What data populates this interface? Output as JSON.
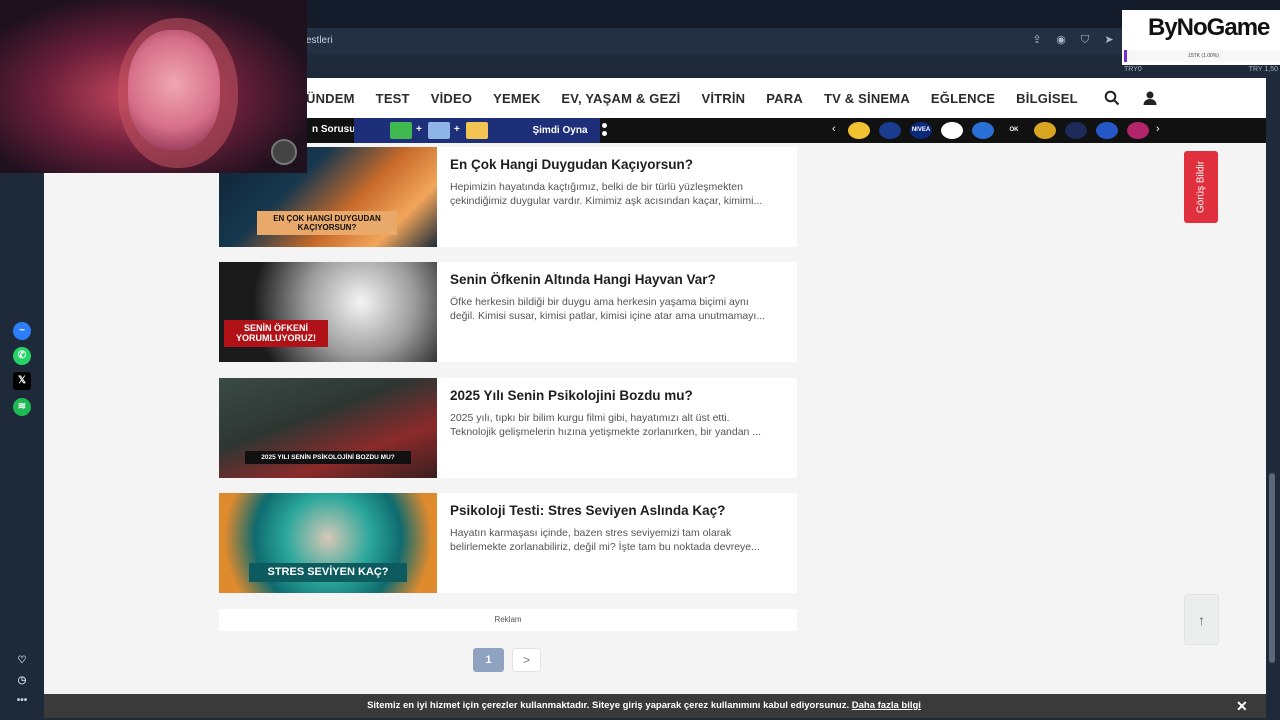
{
  "browser": {
    "address_partial": "estleri"
  },
  "nav": {
    "items": [
      "ÜNDEM",
      "TEST",
      "VİDEO",
      "YEMEK",
      "EV, YAŞAM & GEZİ",
      "VİTRİN",
      "PARA",
      "TV & SİNEMA",
      "EĞLENCE",
      "BİLGİSEL"
    ]
  },
  "strip": {
    "question_label": "n Sorusu",
    "play_label": "Şimdi Oyna"
  },
  "articles": [
    {
      "title": "En Çok Hangi Duygudan Kaçıyorsun?",
      "desc1": "Hepimizin hayatında kaçtığımız, belki de bir türlü yüzleşmekten",
      "desc2": "çekindiğimiz duygular vardır. Kimimiz aşk acısından kaçar, kimimi...",
      "thumb_caption": "EN ÇOK HANGİ DUYGUDAN KAÇIYORSUN?"
    },
    {
      "title": "Senin Öfkenin Altında Hangi Hayvan Var?",
      "desc1": "Öfke herkesin bildiği bir duygu ama herkesin yaşama biçimi aynı",
      "desc2": "değil. Kimisi susar, kimisi patlar, kimisi içine atar ama unutmamayı...",
      "thumb_caption": "SENİN ÖFKENİ YORUMLUYORUZ!"
    },
    {
      "title": "2025 Yılı Senin Psikolojini Bozdu mu?",
      "desc1": "2025 yılı, tıpkı bir bilim kurgu filmi gibi, hayatımızı alt üst etti.",
      "desc2": "Teknolojik gelişmelerin hızına yetişmekte zorlanırken, bir yandan ...",
      "thumb_caption": "2025 YILI SENİN PSİKOLOJİNİ BOZDU MU?"
    },
    {
      "title": "Psikoloji Testi: Stres Seviyen Aslında Kaç?",
      "desc1": "Hayatın karmaşası içinde, bazen stres seviyemizi tam olarak",
      "desc2": "belirlemekte zorlanabiliriz, değil mi? İşte tam bu noktada devreye...",
      "thumb_caption": "STRES SEVİYEN KAÇ?"
    }
  ],
  "ad_label": "Reklam",
  "pagination": {
    "current": "1",
    "next": ">"
  },
  "feedback_label": "Görüş Bildir",
  "scroll_top": "↑",
  "cookie": {
    "text": "Sitemiz en iyi hizmet için çerezler kullanmaktadır. Siteye giriş yaparak çerez kullanımını kabul ediyorsunuz.",
    "link": "Daha fazla bilgi",
    "close": "✕"
  },
  "overlay": {
    "logo": "ByNoGame",
    "bar_text": "15TK (1.00%)",
    "ticker_left": "TRY0",
    "ticker_right": "TRY 1,50"
  },
  "brands": [
    "",
    "",
    "NIVEA",
    "",
    "",
    "OK",
    "",
    "",
    "",
    ""
  ],
  "colors": {
    "accent_red": "#e0303e",
    "game_blue": "#1e2f7a",
    "pager_active": "#8fa2bf"
  }
}
